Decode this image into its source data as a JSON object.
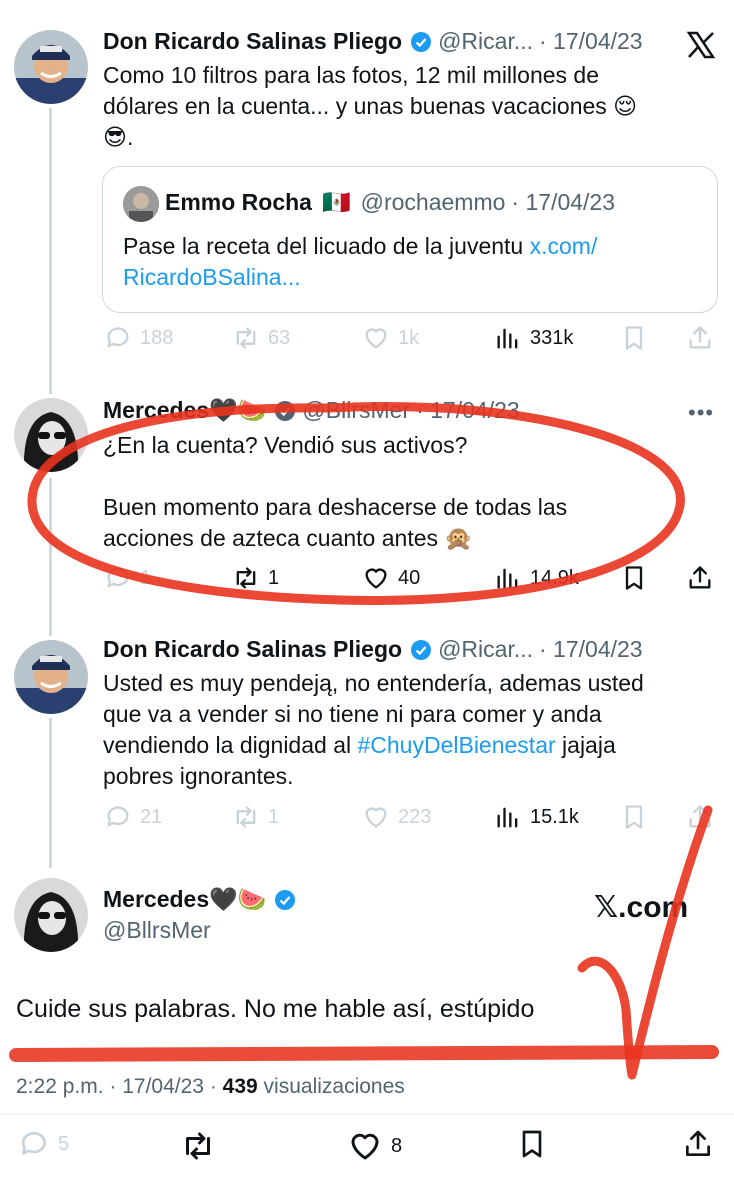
{
  "platform": {
    "logo_icon": "x-logo-icon",
    "watermark": "𝕏.com"
  },
  "tweets": [
    {
      "name": "Don Ricardo Salinas Pliego",
      "handle": "@Ricar...",
      "date": "· 17/04/23",
      "verified": true,
      "text_line1": "Como 10 filtros para las fotos, 12 mil millones de",
      "text_line2": "dólares en la cuenta... y unas buenas vacaciones 😌",
      "text_line3": "😎.",
      "quote": {
        "name": "Emmo Rocha",
        "flag": "🇲🇽",
        "handle": "@rochaemmo",
        "date": "· 17/04/23",
        "text": "Pase la receta del licuado de la juventu ",
        "link1": "x.com/",
        "link2": "RicardoBSalina..."
      },
      "replies": "188",
      "retweets": "63",
      "likes": "1k",
      "views": "331k"
    },
    {
      "name": "Mercedes🖤🍉",
      "handle": "@BllrsMer",
      "date": "· 17/04/23",
      "verified": true,
      "text_line1": "¿En la cuenta? Vendió sus activos?",
      "text_line2": "Buen momento para deshacerse de todas las",
      "text_line3": "acciones de azteca cuanto antes 🙊",
      "replies": "1",
      "retweets": "1",
      "likes": "40",
      "views": "14.9k"
    },
    {
      "name": "Don Ricardo Salinas Pliego",
      "handle": "@Ricar...",
      "date": "· 17/04/23",
      "verified": true,
      "text_line1": "Usted es muy pendeją, no entendería, ademas usted",
      "text_line2": "que va a vender si no tiene ni para comer y anda",
      "text_line3_pre": "vendiendo la dignidad al ",
      "hashtag": "#ChuyDelBienestar",
      "text_line3_post": " jajaja",
      "text_line4": "pobres ignorantes.",
      "replies": "21",
      "retweets": "1",
      "likes": "223",
      "views": "15.1k"
    }
  ],
  "focused": {
    "name": "Mercedes🖤🍉",
    "handle": "@BllrsMer",
    "text": "Cuide sus palabras.  No me hable así, estúpido",
    "time": "2:22 p.m.",
    "date": "· 17/04/23 ·",
    "views_count": "439",
    "views_label": "visualizaciones",
    "replies": "5",
    "likes": "8"
  },
  "colors": {
    "accent": "#1d9bf0",
    "annotation": "#e8331f",
    "line": "#cfd9de"
  }
}
